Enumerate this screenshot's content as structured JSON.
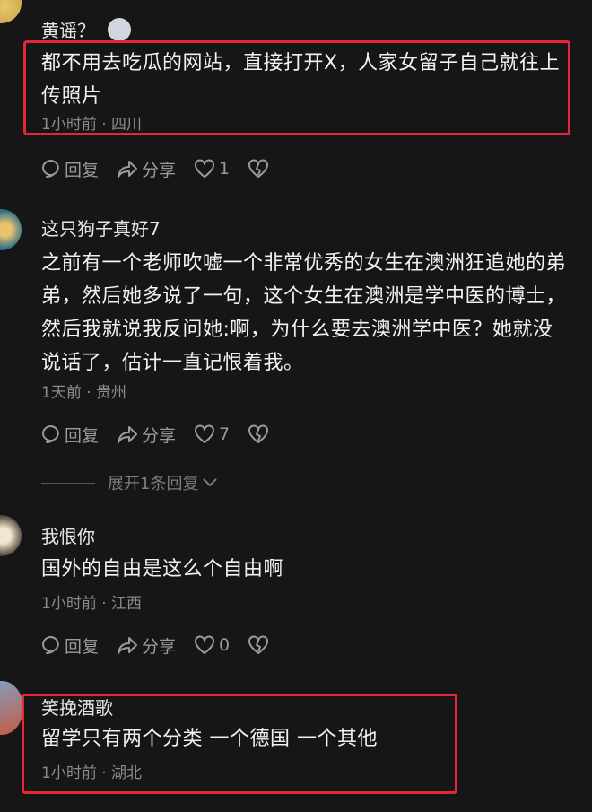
{
  "comments": [
    {
      "username": "",
      "reply_to_label": "黄谣？",
      "text": "都不用去吃瓜的网站，直接打开X，人家女留子自己就往上传照片",
      "meta": "1小时前 · 四川",
      "reply_label": "回复",
      "share_label": "分享",
      "like_count": "1"
    },
    {
      "username": "这只狗子真好7",
      "text": "之前有一个老师吹嘘一个非常优秀的女生在澳洲狂追她的弟弟，然后她多说了一句，这个女生在澳洲是学中医的博士，然后我就说我反问她:啊，为什么要去澳洲学中医？她就没说话了，估计一直记恨着我。",
      "meta": "1天前 · 贵州",
      "reply_label": "回复",
      "share_label": "分享",
      "like_count": "7",
      "expand_label": "展开1条回复"
    },
    {
      "username": "我恨你",
      "text": "国外的自由是这么个自由啊",
      "meta": "1小时前 · 江西",
      "reply_label": "回复",
      "share_label": "分享",
      "like_count": "0"
    },
    {
      "username": "笑挽酒歌",
      "text": "留学只有两个分类  一个德国 一个其他",
      "meta": "1小时前 · 湖北"
    }
  ],
  "colors": {
    "background": "#161616",
    "highlight_border": "#e5263a",
    "meta_text": "#8b8b8b"
  },
  "icons": {
    "reply": "comment-bubble-icon",
    "share": "share-arrow-icon",
    "like": "heart-icon",
    "dislike": "broken-heart-icon"
  }
}
